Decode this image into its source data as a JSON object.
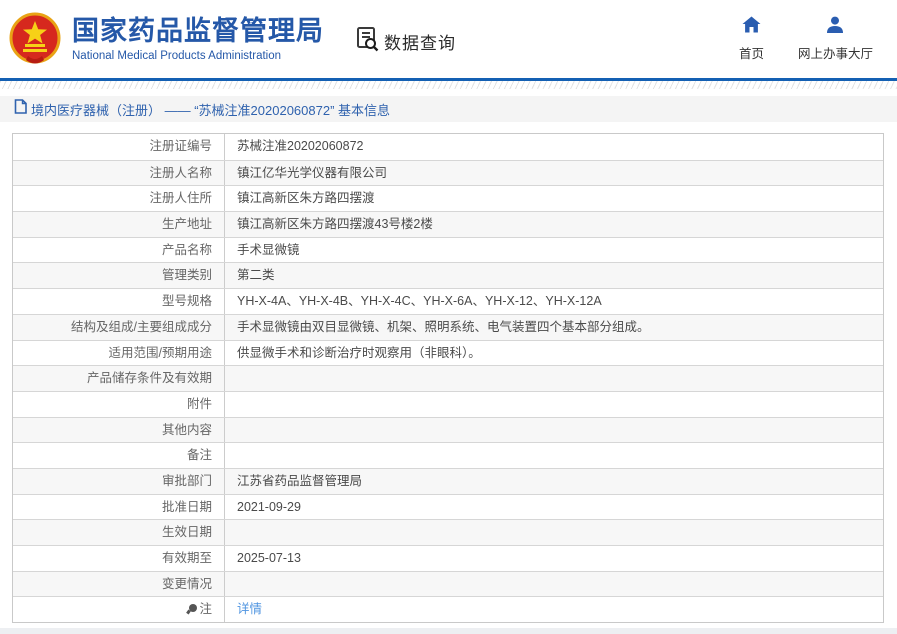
{
  "header": {
    "org_name_cn": "国家药品监督管理局",
    "org_name_en": "National Medical Products Administration",
    "section_title": "数据查询",
    "nav": [
      {
        "label": "首页",
        "icon": "home-icon"
      },
      {
        "label": "网上办事大厅",
        "icon": "user-icon"
      }
    ]
  },
  "breadcrumb": {
    "text": "境内医疗器械（注册） —— “苏械注准20202060872” 基本信息"
  },
  "table": {
    "rows": [
      {
        "label": "注册证编号",
        "value": "苏械注准20202060872"
      },
      {
        "label": "注册人名称",
        "value": "镇江亿华光学仪器有限公司"
      },
      {
        "label": "注册人住所",
        "value": "镇江高新区朱方路四摆渡"
      },
      {
        "label": "生产地址",
        "value": "镇江高新区朱方路四摆渡43号楼2楼"
      },
      {
        "label": "产品名称",
        "value": "手术显微镜"
      },
      {
        "label": "管理类别",
        "value": "第二类"
      },
      {
        "label": "型号规格",
        "value": "YH-X-4A、YH-X-4B、YH-X-4C、YH-X-6A、YH-X-12、YH-X-12A"
      },
      {
        "label": "结构及组成/主要组成成分",
        "value": "手术显微镜由双目显微镜、机架、照明系统、电气装置四个基本部分组成。"
      },
      {
        "label": "适用范围/预期用途",
        "value": "供显微手术和诊断治疗时观察用（非眼科）。"
      },
      {
        "label": "产品储存条件及有效期",
        "value": ""
      },
      {
        "label": "附件",
        "value": ""
      },
      {
        "label": "其他内容",
        "value": ""
      },
      {
        "label": "备注",
        "value": ""
      },
      {
        "label": "审批部门",
        "value": "江苏省药品监督管理局"
      },
      {
        "label": "批准日期",
        "value": "2021-09-29"
      },
      {
        "label": "生效日期",
        "value": ""
      },
      {
        "label": "有效期至",
        "value": "2025-07-13"
      },
      {
        "label": "变更情况",
        "value": ""
      },
      {
        "label": "注",
        "value": "详情",
        "value_is_link": true,
        "label_icon": "note-icon"
      }
    ]
  },
  "colors": {
    "brand_blue": "#2558a8",
    "divider_blue": "#1460b3",
    "link_blue": "#4f94e0",
    "breadcrumb_blue": "#2f62ae",
    "alt_row_bg": "#f7f7f7"
  }
}
